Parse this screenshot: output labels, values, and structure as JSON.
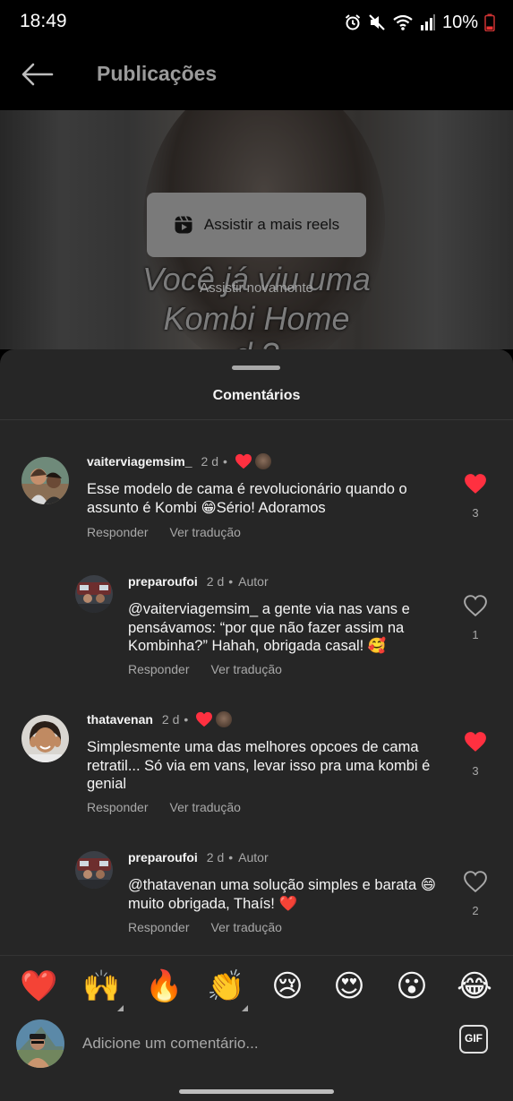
{
  "status_bar": {
    "time": "18:49",
    "battery": "10%"
  },
  "header": {
    "title": "Publicações"
  },
  "video": {
    "watch_more_label": "Assistir a mais reels",
    "watch_again_label": "Assistir novamente",
    "overlay_line1": "Você já viu uma",
    "overlay_line2": "Kombi Home",
    "overlay_line3": "d      ?"
  },
  "sheet": {
    "title": "Comentários"
  },
  "comments": [
    {
      "username": "vaiterviagemsim_",
      "time": "2 d",
      "text": "Esse modelo de cama é revolucionário quando o assunto é Kombi 😁Sério! Adoramos",
      "reply_label": "Responder",
      "translate_label": "Ver tradução",
      "likes": "3",
      "liked": true
    },
    {
      "username": "preparoufoi",
      "time": "2 d",
      "author_label": "Autor",
      "text": "@vaiterviagemsim_ a gente via nas vans e pensávamos: “por que não fazer assim na Kombinha?” Hahah, obrigada casal! 🥰",
      "reply_label": "Responder",
      "translate_label": "Ver tradução",
      "likes": "1",
      "liked": false
    },
    {
      "username": "thatavenan",
      "time": "2 d",
      "text": "Simplesmente uma das melhores opcoes de cama retratil... Só via em vans, levar isso pra uma kombi é genial",
      "reply_label": "Responder",
      "translate_label": "Ver tradução",
      "likes": "3",
      "liked": true
    },
    {
      "username": "preparoufoi",
      "time": "2 d",
      "author_label": "Autor",
      "text": "@thatavenan uma solução simples e barata 😄 muito obrigada, Thaís! ❤️",
      "reply_label": "Responder",
      "translate_label": "Ver tradução",
      "likes": "2",
      "liked": false
    }
  ],
  "emoji_bar": [
    "❤️",
    "🙌",
    "🔥",
    "👏",
    "😢",
    "😍",
    "😮",
    "😂"
  ],
  "input": {
    "placeholder": "Adicione um comentário...",
    "gif_label": "GIF"
  },
  "colors": {
    "like_red": "#ff3040",
    "sheet_bg": "#262626",
    "secondary_text": "#a8a8a8"
  }
}
